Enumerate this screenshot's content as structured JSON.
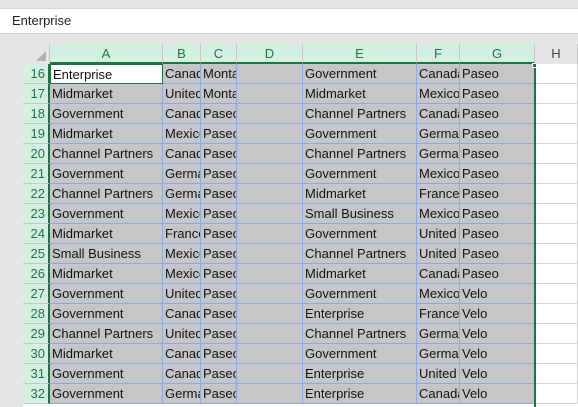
{
  "formula_bar": {
    "value": "Enterprise"
  },
  "columns": [
    "A",
    "B",
    "C",
    "D",
    "E",
    "F",
    "G",
    "H"
  ],
  "rows": [
    {
      "num": "16",
      "a": "Enterprise",
      "b": "Canada",
      "c": "Montana",
      "e": "Government",
      "f": "Canada",
      "g": "Paseo"
    },
    {
      "num": "17",
      "a": "Midmarket",
      "b": "United States",
      "c": "Montana",
      "e": "Midmarket",
      "f": "Mexico",
      "g": "Paseo"
    },
    {
      "num": "18",
      "a": "Government",
      "b": "Canada",
      "c": "Paseo",
      "e": "Channel Partners",
      "f": "Canada",
      "g": "Paseo"
    },
    {
      "num": "19",
      "a": "Midmarket",
      "b": "Mexico",
      "c": "Paseo",
      "e": "Government",
      "f": "Germany",
      "g": "Paseo"
    },
    {
      "num": "20",
      "a": "Channel Partners",
      "b": "Canada",
      "c": "Paseo",
      "e": "Channel Partners",
      "f": "Germany",
      "g": "Paseo"
    },
    {
      "num": "21",
      "a": "Government",
      "b": "Germany",
      "c": "Paseo",
      "e": "Government",
      "f": "Mexico",
      "g": "Paseo"
    },
    {
      "num": "22",
      "a": "Channel Partners",
      "b": "Germany",
      "c": "Paseo",
      "e": "Midmarket",
      "f": "France",
      "g": "Paseo"
    },
    {
      "num": "23",
      "a": "Government",
      "b": "Mexico",
      "c": "Paseo",
      "e": "Small Business",
      "f": "Mexico",
      "g": "Paseo"
    },
    {
      "num": "24",
      "a": "Midmarket",
      "b": "France",
      "c": "Paseo",
      "e": "Government",
      "f": "United States",
      "g": "Paseo"
    },
    {
      "num": "25",
      "a": "Small Business",
      "b": "Mexico",
      "c": "Paseo",
      "e": "Channel Partners",
      "f": "United States",
      "g": "Paseo"
    },
    {
      "num": "26",
      "a": "Midmarket",
      "b": "Mexico",
      "c": "Paseo",
      "e": "Midmarket",
      "f": "Canada",
      "g": "Paseo"
    },
    {
      "num": "27",
      "a": "Government",
      "b": "United States",
      "c": "Paseo",
      "e": "Government",
      "f": "Mexico",
      "g": "Velo"
    },
    {
      "num": "28",
      "a": "Government",
      "b": "Canada",
      "c": "Paseo",
      "e": "Enterprise",
      "f": "France",
      "g": "Velo"
    },
    {
      "num": "29",
      "a": "Channel Partners",
      "b": "United States",
      "c": "Paseo",
      "e": "Channel Partners",
      "f": "Germany",
      "g": "Velo"
    },
    {
      "num": "30",
      "a": "Midmarket",
      "b": "Canada",
      "c": "Paseo",
      "e": "Government",
      "f": "Germany",
      "g": "Velo"
    },
    {
      "num": "31",
      "a": "Government",
      "b": "Canada",
      "c": "Paseo",
      "e": "Enterprise",
      "f": "United States",
      "g": "Velo"
    },
    {
      "num": "32",
      "a": "Government",
      "b": "Germany",
      "c": "Paseo",
      "e": "Enterprise",
      "f": "Canada",
      "g": "Velo"
    }
  ],
  "colors": {
    "selection_accent": "#217346",
    "selected_fill": "#c6c6c6",
    "header_selected_fill": "#d3f0e0"
  }
}
